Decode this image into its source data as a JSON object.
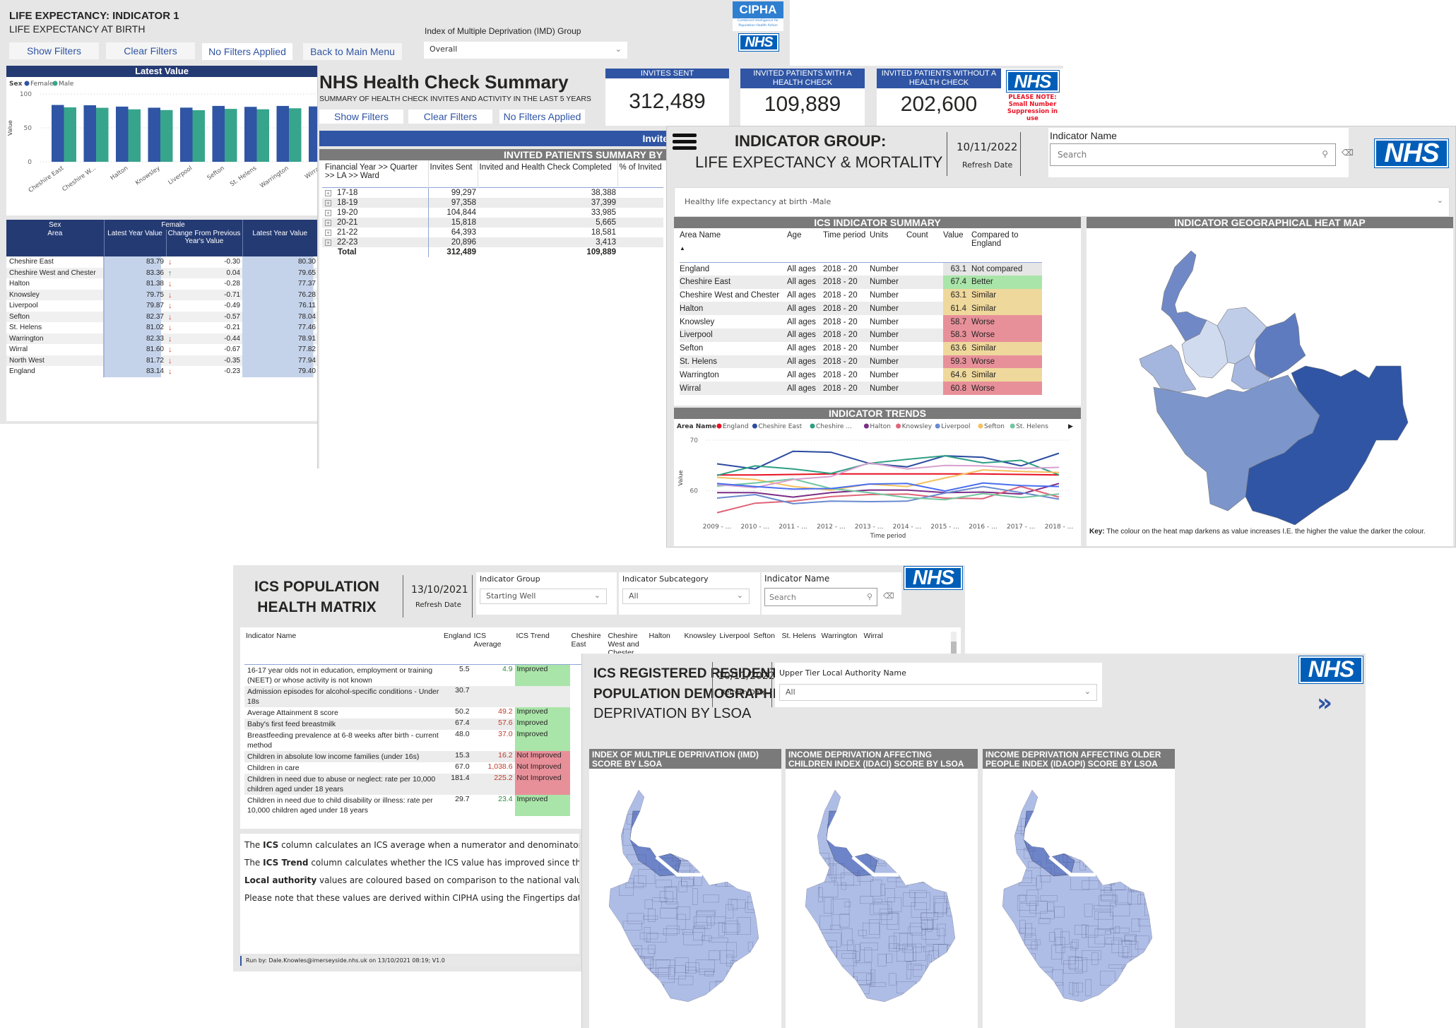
{
  "le_panel": {
    "title": "LIFE EXPECTANCY: INDICATOR 1",
    "subtitle": "LIFE EXPECTANCY AT BIRTH",
    "buttons": {
      "show_filters": "Show Filters",
      "clear_filters": "Clear Filters",
      "no_filters": "No Filters Applied",
      "back": "Back to Main Menu"
    },
    "imd_label": "Index of Multiple Deprivation (IMD) Group",
    "imd_value": "Overall",
    "chart_header": "Latest Value",
    "logo": {
      "cipha": "CIPHA",
      "cipha_sub1": "Combined Intelligence for",
      "cipha_sub2": "Population Health Action",
      "nhs": "NHS"
    },
    "table": {
      "header_sex": "Sex",
      "header_area": "Area",
      "header_female": "Female",
      "cols": [
        "Latest Year Value",
        "Change From Previous Year's Value",
        "Latest Year Value"
      ],
      "rows": [
        {
          "area": "Cheshire East",
          "f": "83.79",
          "dir": "down",
          "chg": "-0.30",
          "m": "80.30"
        },
        {
          "area": "Cheshire West and Chester",
          "f": "83.36",
          "dir": "up",
          "chg": "0.04",
          "m": "79.65"
        },
        {
          "area": "Halton",
          "f": "81.38",
          "dir": "down",
          "chg": "-0.28",
          "m": "77.37"
        },
        {
          "area": "Knowsley",
          "f": "79.75",
          "dir": "down",
          "chg": "-0.71",
          "m": "76.28"
        },
        {
          "area": "Liverpool",
          "f": "79.87",
          "dir": "down",
          "chg": "-0.49",
          "m": "76.11"
        },
        {
          "area": "Sefton",
          "f": "82.37",
          "dir": "down",
          "chg": "-0.57",
          "m": "78.04"
        },
        {
          "area": "St. Helens",
          "f": "81.02",
          "dir": "down",
          "chg": "-0.21",
          "m": "77.46"
        },
        {
          "area": "Warrington",
          "f": "82.33",
          "dir": "down",
          "chg": "-0.44",
          "m": "78.91"
        },
        {
          "area": "Wirral",
          "f": "81.60",
          "dir": "down",
          "chg": "-0.67",
          "m": "77.82"
        },
        {
          "area": "North West",
          "f": "81.72",
          "dir": "down",
          "chg": "-0.35",
          "m": "77.94"
        },
        {
          "area": "England",
          "f": "83.14",
          "dir": "down",
          "chg": "-0.23",
          "m": "79.40"
        }
      ]
    }
  },
  "chart_data": [
    {
      "type": "bar",
      "title": "Latest Value",
      "legend_title": "Sex",
      "categories": [
        "Cheshire East",
        "Cheshire W...",
        "Halton",
        "Knowsley",
        "Liverpool",
        "Sefton",
        "St. Helens",
        "Warrington",
        "Wirral"
      ],
      "series": [
        {
          "name": "Female",
          "color": "#2f55a4",
          "values": [
            83.79,
            83.36,
            81.38,
            79.75,
            79.87,
            82.37,
            81.02,
            82.33,
            81.6
          ]
        },
        {
          "name": "Male",
          "color": "#37a58c",
          "values": [
            80.3,
            79.65,
            77.37,
            76.28,
            76.11,
            78.04,
            77.46,
            78.91,
            77.82
          ]
        }
      ],
      "xlabel": "",
      "ylabel": "Value",
      "ylim": [
        0,
        100
      ],
      "yticks": [
        0,
        50,
        100
      ],
      "grid": true,
      "legend_position": "top-left"
    },
    {
      "type": "line",
      "title": "INDICATOR TRENDS",
      "legend_title": "Area Name",
      "x": [
        "2009 - ...",
        "2010 - ...",
        "2011 - ...",
        "2012 - ...",
        "2013 - ...",
        "2014 - ...",
        "2015 - ...",
        "2016 - ...",
        "2017 - ...",
        "2018 - ..."
      ],
      "series": [
        {
          "name": "England",
          "color": "#e81123",
          "values": [
            63.1,
            63.1,
            63.2,
            63.3,
            63.3,
            63.3,
            63.3,
            63.3,
            63.2,
            63.1
          ]
        },
        {
          "name": "Cheshire East",
          "color": "#2a4aa0",
          "values": [
            65.3,
            64.3,
            67.8,
            67.6,
            65.4,
            64.7,
            66.9,
            66.6,
            64.9,
            67.4
          ]
        },
        {
          "name": "Cheshire ...",
          "color": "#2e9e83",
          "values": [
            63.0,
            64.9,
            64.3,
            63.4,
            65.4,
            66.2,
            66.9,
            65.5,
            66.0,
            63.1
          ]
        },
        {
          "name": "Halton",
          "color": "#7b2d86",
          "values": [
            59.6,
            59.6,
            58.7,
            59.6,
            60.1,
            60.1,
            59.6,
            59.7,
            59.3,
            61.4
          ]
        },
        {
          "name": "Knowsley",
          "color": "#e06477",
          "values": [
            55.6,
            57.5,
            57.9,
            58.8,
            59.2,
            59.3,
            58.5,
            58.4,
            60.8,
            58.7
          ]
        },
        {
          "name": "Liverpool",
          "color": "#6a8ad0",
          "values": [
            58.5,
            59.2,
            57.4,
            57.9,
            57.8,
            57.9,
            59.5,
            60.8,
            59.6,
            58.3
          ]
        },
        {
          "name": "Sefton",
          "color": "#f5c060",
          "values": [
            62.6,
            62.2,
            60.8,
            60.1,
            61.3,
            60.8,
            62.5,
            64.1,
            63.8,
            63.6
          ]
        },
        {
          "name": "St. Helens",
          "color": "#73c6a0",
          "values": [
            60.9,
            61.5,
            62.3,
            60.4,
            59.6,
            58.6,
            58.2,
            59.4,
            58.6,
            59.3
          ]
        },
        {
          "name": "Warrington",
          "color": "#d8a0d0",
          "values": [
            61.2,
            60.6,
            62.2,
            62.8,
            65.5,
            64.3,
            65.0,
            64.9,
            64.4,
            64.6
          ]
        },
        {
          "name": "Wirral",
          "color": "#4a6ef0",
          "values": [
            61.4,
            60.8,
            60.3,
            60.4,
            61.3,
            61.4,
            59.9,
            61.5,
            61.0,
            60.8
          ]
        }
      ],
      "xlabel": "Time period",
      "ylabel": "Value",
      "ylim": [
        55,
        70
      ],
      "yticks": [
        60,
        70
      ],
      "grid": true,
      "legend_position": "top"
    }
  ],
  "hc_panel": {
    "title": "NHS Health Check Summary",
    "subtitle": "SUMMARY OF HEALTH CHECK INVITES AND ACTIVITY IN THE LAST 5 YEARS",
    "buttons": {
      "show_filters": "Show Filters",
      "clear_filters": "Clear Filters",
      "no_filters": "No Filters Applied"
    },
    "view_header": "Invited Patients View",
    "summary_header": "INVITED PATIENTS SUMMARY BY",
    "kpis": [
      {
        "label": "INVITES SENT",
        "value": "312,489"
      },
      {
        "label": "INVITED PATIENTS WITH A HEALTH CHECK",
        "value": "109,889"
      },
      {
        "label": "INVITED PATIENTS WITHOUT A HEALTH CHECK",
        "value": "202,600"
      }
    ],
    "note": "PLEASE NOTE: Small Number Suppression in use",
    "nhs": "NHS",
    "cols": [
      "Financial Year >> Quarter >> LA >> Ward",
      "Invites Sent",
      "Invited and Health Check Completed",
      "% of Invited"
    ],
    "rows": [
      {
        "year": "17-18",
        "sent": "99,297",
        "done": "38,388"
      },
      {
        "year": "18-19",
        "sent": "97,358",
        "done": "37,399"
      },
      {
        "year": "19-20",
        "sent": "104,844",
        "done": "33,985"
      },
      {
        "year": "20-21",
        "sent": "15,818",
        "done": "5,665"
      },
      {
        "year": "21-22",
        "sent": "64,393",
        "done": "18,581"
      },
      {
        "year": "22-23",
        "sent": "20,896",
        "done": "3,413"
      }
    ],
    "total": {
      "label": "Total",
      "sent": "312,489",
      "done": "109,889"
    }
  },
  "ig_panel": {
    "title": "INDICATOR GROUP:",
    "subtitle": "LIFE EXPECTANCY & MORTALITY",
    "refresh_date": "10/11/2022",
    "refresh_label": "Refresh Date",
    "indicator_label": "Indicator Name",
    "search_placeholder": "Search",
    "selected_indicator": "Healthy life expectancy at birth -Male",
    "nhs": "NHS",
    "summary_header": "ICS INDICATOR SUMMARY",
    "map_header": "INDICATOR GEOGRAPHICAL HEAT MAP",
    "trends_header": "INDICATOR TRENDS",
    "map_key_bold": "Key:",
    "map_key": "The colour on the heat map darkens as value increases I.E. the higher the value the darker the colour.",
    "cols": [
      "Area Name",
      "Age",
      "Time period",
      "Units",
      "Count",
      "Value",
      "Compared to England"
    ],
    "rows": [
      {
        "area": "England",
        "age": "All ages",
        "period": "2018 - 20",
        "units": "Number",
        "count": "",
        "value": "63.1",
        "cmp": "Not compared",
        "status": "none"
      },
      {
        "area": "Cheshire East",
        "age": "All ages",
        "period": "2018 - 20",
        "units": "Number",
        "count": "",
        "value": "67.4",
        "cmp": "Better",
        "status": "better"
      },
      {
        "area": "Cheshire West and Chester",
        "age": "All ages",
        "period": "2018 - 20",
        "units": "Number",
        "count": "",
        "value": "63.1",
        "cmp": "Similar",
        "status": "similar"
      },
      {
        "area": "Halton",
        "age": "All ages",
        "period": "2018 - 20",
        "units": "Number",
        "count": "",
        "value": "61.4",
        "cmp": "Similar",
        "status": "similar"
      },
      {
        "area": "Knowsley",
        "age": "All ages",
        "period": "2018 - 20",
        "units": "Number",
        "count": "",
        "value": "58.7",
        "cmp": "Worse",
        "status": "worse"
      },
      {
        "area": "Liverpool",
        "age": "All ages",
        "period": "2018 - 20",
        "units": "Number",
        "count": "",
        "value": "58.3",
        "cmp": "Worse",
        "status": "worse"
      },
      {
        "area": "Sefton",
        "age": "All ages",
        "period": "2018 - 20",
        "units": "Number",
        "count": "",
        "value": "63.6",
        "cmp": "Similar",
        "status": "similar"
      },
      {
        "area": "St. Helens",
        "age": "All ages",
        "period": "2018 - 20",
        "units": "Number",
        "count": "",
        "value": "59.3",
        "cmp": "Worse",
        "status": "worse"
      },
      {
        "area": "Warrington",
        "age": "All ages",
        "period": "2018 - 20",
        "units": "Number",
        "count": "",
        "value": "64.6",
        "cmp": "Similar",
        "status": "similar"
      },
      {
        "area": "Wirral",
        "age": "All ages",
        "period": "2018 - 20",
        "units": "Number",
        "count": "",
        "value": "60.8",
        "cmp": "Worse",
        "status": "worse"
      }
    ],
    "status_colors": {
      "none": "#e6e6e6",
      "better": "#a9e5a9",
      "similar": "#efd89c",
      "worse": "#e8909a"
    }
  },
  "matrix_panel": {
    "title1": "ICS POPULATION",
    "title2": "HEALTH MATRIX",
    "refresh_date": "13/10/2021",
    "refresh_label": "Refresh Date",
    "group_label": "Indicator Group",
    "group_value": "Starting Well",
    "subcat_label": "Indicator Subcategory",
    "subcat_value": "All",
    "name_label": "Indicator Name",
    "search_placeholder": "Search",
    "nhs": "NHS",
    "cols": [
      "Indicator Name",
      "England",
      "ICS Average",
      "ICS Trend",
      "Cheshire East",
      "Cheshire West and Chester",
      "Halton",
      "Knowsley",
      "Liverpool",
      "Sefton",
      "St. Helens",
      "Warrington",
      "Wirral"
    ],
    "rows": [
      {
        "name": "16-17 year olds not in education, employment or training (NEET) or whose activity is not known",
        "eng": "5.5",
        "ics": "4.9",
        "ics_good": true,
        "trend": "Improved"
      },
      {
        "name": "Admission episodes for alcohol-specific conditions - Under 18s",
        "eng": "30.7",
        "ics": "",
        "ics_good": true,
        "trend": ""
      },
      {
        "name": "Average Attainment 8 score",
        "eng": "50.2",
        "ics": "49.2",
        "ics_good": false,
        "trend": "Improved"
      },
      {
        "name": "Baby's first feed breastmilk",
        "eng": "67.4",
        "ics": "57.6",
        "ics_good": false,
        "trend": "Improved"
      },
      {
        "name": "Breastfeeding prevalence at 6-8 weeks after birth - current method",
        "eng": "48.0",
        "ics": "37.0",
        "ics_good": false,
        "trend": "Improved"
      },
      {
        "name": "Children in absolute low income families (under 16s)",
        "eng": "15.3",
        "ics": "16.2",
        "ics_good": false,
        "trend": "Not Improved"
      },
      {
        "name": "Children in care",
        "eng": "67.0",
        "ics": "1,038.6",
        "ics_good": false,
        "trend": "Not Improved"
      },
      {
        "name": "Children in need due to abuse or neglect: rate per 10,000 children aged under 18 years",
        "eng": "181.4",
        "ics": "225.2",
        "ics_good": false,
        "trend": "Not Improved"
      },
      {
        "name": "Children in need due to child disability or illness: rate per 10,000 children aged under 18 years",
        "eng": "29.7",
        "ics": "23.4",
        "ics_good": true,
        "trend": "Improved"
      }
    ],
    "notes": [
      {
        "bold": "ICS",
        "pre": "The ",
        "text": " column calculates an ICS average when a numerator and denominator is England value the font will be green, otherwise, it will be red."
      },
      {
        "bold": "ICS Trend",
        "pre": "The ",
        "text": " column calculates whether the ICS value has improved since the pr"
      },
      {
        "bold": "Local authority",
        "pre": "",
        "text": " values are coloured based on comparison to the national value c amber - no significant difference and green - significantly better than the nationa"
      },
      {
        "bold": "",
        "pre": "",
        "text": "Please note that these values are derived within CIPHA using the Fingertips data."
      }
    ],
    "footer": "Run by: Dale.Knowles@imerseyside.nhs.uk on 13/10/2021 08:19; V1.0"
  },
  "demo_panel": {
    "title1": "ICS REGISTERED RESIDENT",
    "title2": "POPULATION DEMOGRAPHICS",
    "subtitle": "DEPRIVATION BY LSOA",
    "refresh_date": "10/11/2022",
    "refresh_label": "Refresh Date",
    "la_label": "Upper Tier Local Authority Name",
    "la_value": "All",
    "nhs": "NHS",
    "next_icon": "double-chevron-right",
    "maps": [
      {
        "title": "INDEX OF MULTIPLE DEPRIVATION (IMD) SCORE BY LSOA"
      },
      {
        "title": "INCOME DEPRIVATION AFFECTING CHILDREN INDEX (IDACI) SCORE BY LSOA"
      },
      {
        "title": "INCOME DEPRIVATION AFFECTING OLDER PEOPLE INDEX (IDAOPI) SCORE BY LSOA"
      }
    ]
  }
}
